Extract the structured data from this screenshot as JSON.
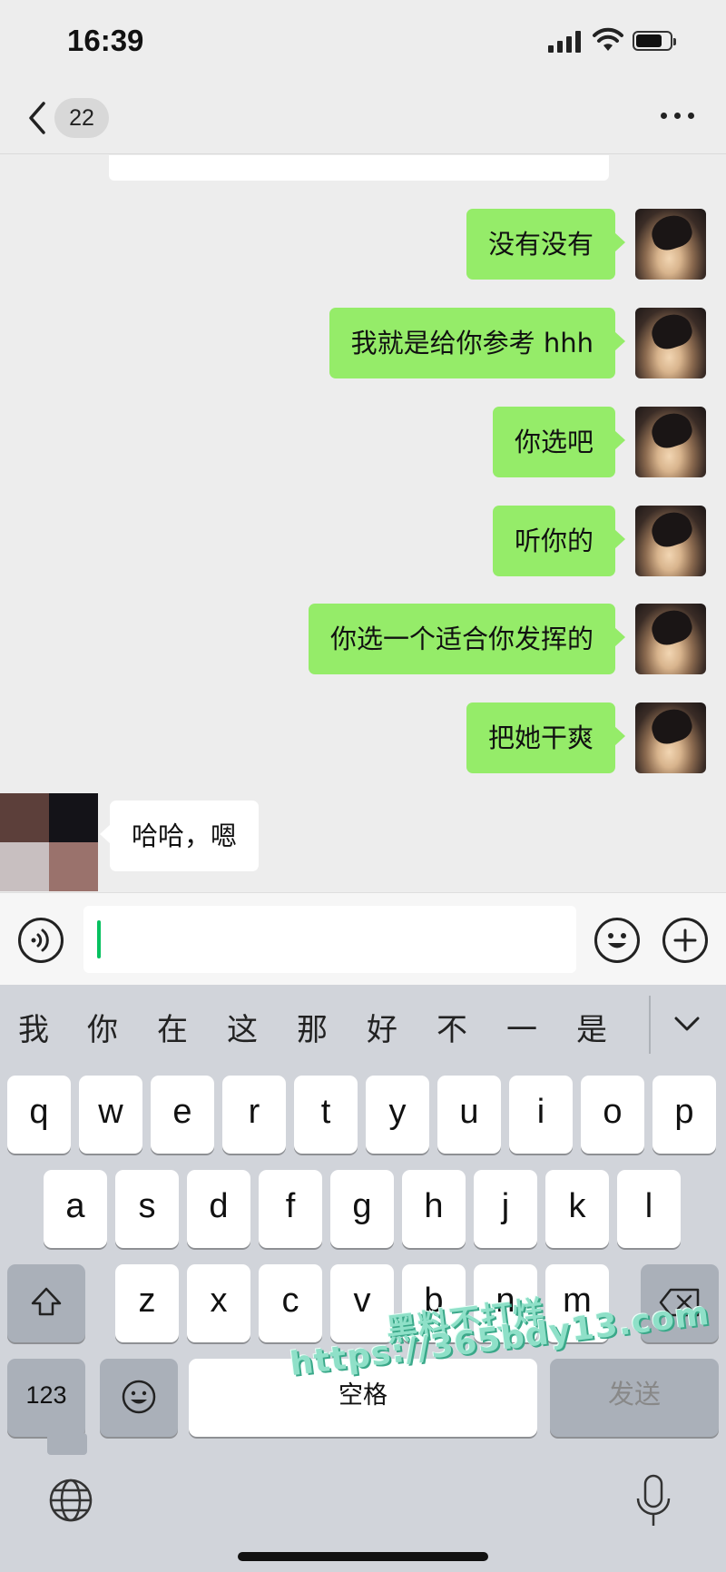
{
  "status_bar": {
    "time": "16:39"
  },
  "nav": {
    "unread_count": "22"
  },
  "messages": [
    {
      "side": "out",
      "text": "没有没有"
    },
    {
      "side": "out",
      "text": "我就是给你参考 hhh"
    },
    {
      "side": "out",
      "text": "你选吧"
    },
    {
      "side": "out",
      "text": "听你的"
    },
    {
      "side": "out",
      "text": "你选一个适合你发挥的"
    },
    {
      "side": "out",
      "text": "把她干爽"
    },
    {
      "side": "in",
      "text": "哈哈，嗯"
    }
  ],
  "input": {
    "value": ""
  },
  "keyboard": {
    "candidates": [
      "我",
      "你",
      "在",
      "这",
      "那",
      "好",
      "不",
      "一",
      "是"
    ],
    "row1": [
      "q",
      "w",
      "e",
      "r",
      "t",
      "y",
      "u",
      "i",
      "o",
      "p"
    ],
    "row2": [
      "a",
      "s",
      "d",
      "f",
      "g",
      "h",
      "j",
      "k",
      "l"
    ],
    "row3": [
      "z",
      "x",
      "c",
      "v",
      "b",
      "n",
      "m"
    ],
    "numbers_label": "123",
    "space_label": "空格",
    "send_label": "发送"
  },
  "watermark": {
    "line1": "黑料不打烊",
    "line2": "https://365bdy13.com"
  }
}
